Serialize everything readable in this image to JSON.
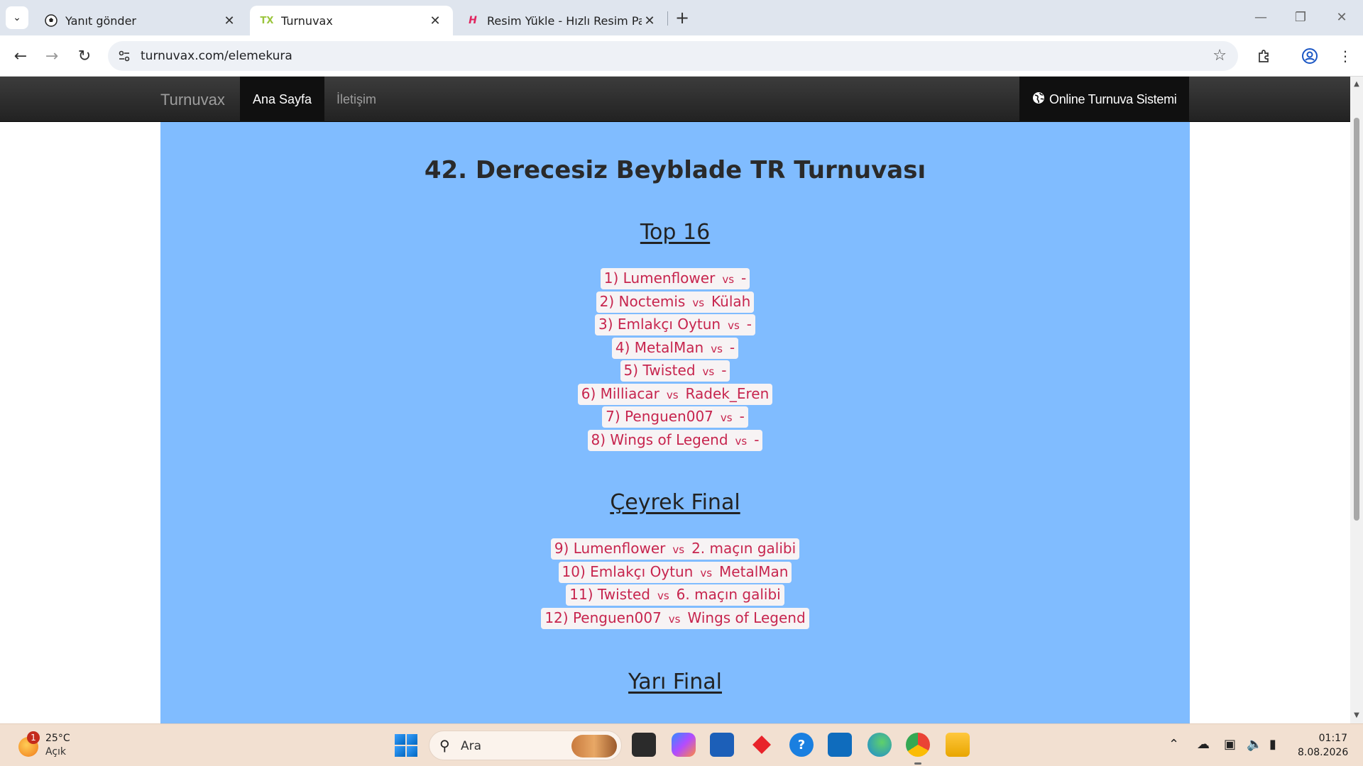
{
  "browser": {
    "tabs": [
      {
        "title": "Yanıt gönder",
        "favicon": "soccer-ball-icon",
        "active": false
      },
      {
        "title": "Turnuvax",
        "favicon": "turnuvax-logo-icon",
        "active": true
      },
      {
        "title": "Resim Yükle - Hızlı Resim Paylaş",
        "favicon": "hizli-resim-logo-icon",
        "active": false
      }
    ],
    "url": "turnuvax.com/elemekura"
  },
  "site": {
    "brand": "Turnuvax",
    "nav": {
      "home": "Ana Sayfa",
      "contact": "İletişim",
      "right": "Online Turnuva Sistemi"
    },
    "title": "42. Derecesiz Beyblade TR Turnuvası",
    "rounds": [
      {
        "name": "Top 16",
        "matches": [
          {
            "label": "1) Lumenflower",
            "opponent": "-"
          },
          {
            "label": "2) Noctemis",
            "opponent": "Külah"
          },
          {
            "label": "3) Emlakçı Oytun",
            "opponent": "-"
          },
          {
            "label": "4) MetalMan",
            "opponent": "-"
          },
          {
            "label": "5) Twisted",
            "opponent": "-"
          },
          {
            "label": "6) Milliacar",
            "opponent": "Radek_Eren"
          },
          {
            "label": "7) Penguen007",
            "opponent": "-"
          },
          {
            "label": "8) Wings of Legend",
            "opponent": "-"
          }
        ]
      },
      {
        "name": "Çeyrek Final",
        "matches": [
          {
            "label": "9) Lumenflower",
            "opponent": "2. maçın galibi"
          },
          {
            "label": "10) Emlakçı Oytun",
            "opponent": "MetalMan"
          },
          {
            "label": "11) Twisted",
            "opponent": "6. maçın galibi"
          },
          {
            "label": "12) Penguen007",
            "opponent": "Wings of Legend"
          }
        ]
      },
      {
        "name": "Yarı Final",
        "matches": []
      }
    ],
    "vs_label": "vs",
    "colors": {
      "content_bg": "#80bcff",
      "match_text": "#c7254e",
      "match_bg": "#f7f3f4",
      "navbar_bg": "#222222"
    }
  },
  "taskbar": {
    "weather_temp": "25°C",
    "weather_cond": "Açık",
    "weather_badge": "1",
    "search_placeholder": "Ara",
    "time": "01:17",
    "date": "8.08.2026"
  }
}
